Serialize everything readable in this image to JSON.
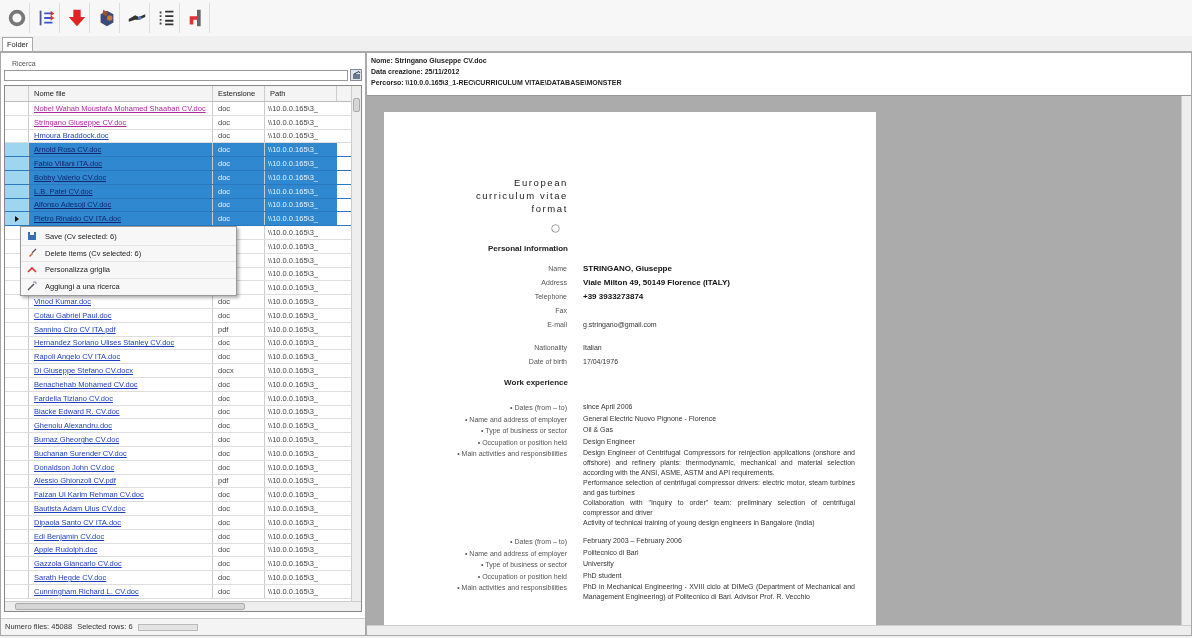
{
  "toolbar": {
    "buttons": [
      {
        "kind": "refresh"
      },
      {
        "kind": "move"
      },
      {
        "kind": "download"
      },
      {
        "kind": "package"
      },
      {
        "kind": "tool"
      },
      {
        "kind": "list"
      },
      {
        "kind": "pipe"
      }
    ]
  },
  "tabs": [
    {
      "label": "Folder",
      "selected": true
    }
  ],
  "search": {
    "label": "Ricerca"
  },
  "file_table": {
    "columns": [
      "Nome file",
      "Estensione",
      "Path"
    ],
    "rows": [
      {
        "name": "Nobel Wahab Moustafa Mohamed Shaaban CV.doc",
        "extension": "doc",
        "path": "\\\\10.0.0.165\\3_",
        "selected": false,
        "visited": true,
        "current": false
      },
      {
        "name": "Stringano Giuseppe CV.doc",
        "extension": "doc",
        "path": "\\\\10.0.0.165\\3_",
        "selected": false,
        "visited": true,
        "current": false
      },
      {
        "name": "Hmoura Braddock.doc",
        "extension": "doc",
        "path": "\\\\10.0.0.165\\3_",
        "selected": false,
        "visited": false,
        "current": false
      },
      {
        "name": "Arnold Rosa CV.doc",
        "extension": "doc",
        "path": "\\\\10.0.0.165\\3_",
        "selected": true,
        "current": false
      },
      {
        "name": "Fabio Villani ITA.doc",
        "extension": "doc",
        "path": "\\\\10.0.0.165\\3_",
        "selected": true,
        "current": false
      },
      {
        "name": "Bobby Valerio CV.doc",
        "extension": "doc",
        "path": "\\\\10.0.0.165\\3_",
        "selected": true,
        "current": false
      },
      {
        "name": "L.B. Patel CV.doc",
        "extension": "doc",
        "path": "\\\\10.0.0.165\\3_",
        "selected": true,
        "current": false
      },
      {
        "name": "Alfonso Adesoji CV.doc",
        "extension": "doc",
        "path": "\\\\10.0.0.165\\3_",
        "selected": true,
        "current": false
      },
      {
        "name": "Pietro Rinaldo CV ITA.doc",
        "extension": "doc",
        "path": "\\\\10.0.0.165\\3_",
        "selected": true,
        "current": true
      },
      {
        "path": "\\\\10.0.0.165\\3_",
        "selected": false,
        "current": false
      },
      {
        "path": "\\\\10.0.0.165\\3_",
        "selected": false,
        "current": false
      },
      {
        "path": "\\\\10.0.0.165\\3_",
        "selected": false,
        "current": false
      },
      {
        "path": "\\\\10.0.0.165\\3_",
        "selected": false,
        "current": false
      },
      {
        "path": "\\\\10.0.0.165\\3_",
        "selected": false,
        "current": false
      },
      {
        "name": "Vinod Kumar.doc",
        "extension": "doc",
        "path": "\\\\10.0.0.165\\3_",
        "selected": false,
        "visited": false,
        "current": false
      },
      {
        "name": "Cotau Gabriel Paul.doc",
        "extension": "doc",
        "path": "\\\\10.0.0.165\\3_",
        "selected": false,
        "visited": false,
        "current": false
      },
      {
        "name": "Sannino Ciro CV ITA.pdf",
        "extension": "pdf",
        "path": "\\\\10.0.0.165\\3_",
        "selected": false,
        "visited": false,
        "current": false
      },
      {
        "name": "Hernandez Soriano Ulises Stanley CV.doc",
        "extension": "doc",
        "path": "\\\\10.0.0.165\\3_",
        "selected": false,
        "visited": false,
        "current": false
      },
      {
        "name": "Rapoli Angelo CV ITA.doc",
        "extension": "doc",
        "path": "\\\\10.0.0.165\\3_",
        "selected": false,
        "visited": false,
        "current": false
      },
      {
        "name": "Di Giuseppe Stefano CV.docx",
        "extension": "docx",
        "path": "\\\\10.0.0.165\\3_",
        "selected": false,
        "visited": false,
        "current": false
      },
      {
        "name": "Benachehab Mohamed CV.doc",
        "extension": "doc",
        "path": "\\\\10.0.0.165\\3_",
        "selected": false,
        "visited": false,
        "current": false
      },
      {
        "name": "Fardella Tiziano CV.doc",
        "extension": "doc",
        "path": "\\\\10.0.0.165\\3_",
        "selected": false,
        "visited": false,
        "current": false
      },
      {
        "name": "Blacke Edward R. CV.doc",
        "extension": "doc",
        "path": "\\\\10.0.0.165\\3_",
        "selected": false,
        "visited": false,
        "current": false
      },
      {
        "name": "Ghenoiu Alexandru.doc",
        "extension": "doc",
        "path": "\\\\10.0.0.165\\3_",
        "selected": false,
        "visited": false,
        "current": false
      },
      {
        "name": "Burnaz Gheorghe CV.doc",
        "extension": "doc",
        "path": "\\\\10.0.0.165\\3_",
        "selected": false,
        "visited": false,
        "current": false
      },
      {
        "name": "Buchanan Surender CV.doc",
        "extension": "doc",
        "path": "\\\\10.0.0.165\\3_",
        "selected": false,
        "visited": false,
        "current": false
      },
      {
        "name": "Donaldson John CV.doc",
        "extension": "doc",
        "path": "\\\\10.0.0.165\\3_",
        "selected": false,
        "visited": false,
        "current": false
      },
      {
        "name": "Alessio Ghionzoli CV.pdf",
        "extension": "pdf",
        "path": "\\\\10.0.0.165\\3_",
        "selected": false,
        "visited": false,
        "current": false
      },
      {
        "name": "Faizan Ul Karim Rehman CV.doc",
        "extension": "doc",
        "path": "\\\\10.0.0.165\\3_",
        "selected": false,
        "visited": false,
        "current": false
      },
      {
        "name": "Bautista Adam Ulus CV.doc",
        "extension": "doc",
        "path": "\\\\10.0.0.165\\3_",
        "selected": false,
        "visited": false,
        "current": false
      },
      {
        "name": "Dipaola Santo CV ITA.doc",
        "extension": "doc",
        "path": "\\\\10.0.0.165\\3_",
        "selected": false,
        "visited": false,
        "current": false
      },
      {
        "name": "Edi Benjamin CV.doc",
        "extension": "doc",
        "path": "\\\\10.0.0.165\\3_",
        "selected": false,
        "visited": false,
        "current": false
      },
      {
        "name": "Apple Rudolph.doc",
        "extension": "doc",
        "path": "\\\\10.0.0.165\\3_",
        "selected": false,
        "visited": false,
        "current": false
      },
      {
        "name": "Gazzola Giancarlo CV.doc",
        "extension": "doc",
        "path": "\\\\10.0.0.165\\3_",
        "selected": false,
        "visited": false,
        "current": false
      },
      {
        "name": "Sarath Hegde CV.doc",
        "extension": "doc",
        "path": "\\\\10.0.0.165\\3_",
        "selected": false,
        "visited": false,
        "current": false
      },
      {
        "name": "Cunningham Richard L. CV.doc",
        "extension": "doc",
        "path": "\\\\10.0.0.165\\3_",
        "selected": false,
        "visited": false,
        "current": false
      }
    ]
  },
  "context_menu": {
    "items": [
      {
        "label": "Save (Cv selected: 6)",
        "kind": "save"
      },
      {
        "label": "Delete items (Cv selected: 6)",
        "kind": "delete"
      },
      {
        "label": "Personalizza griglia",
        "kind": "grid"
      },
      {
        "label": "Aggiungi a una ricerca",
        "kind": "add"
      }
    ]
  },
  "status_bar": {
    "file_count": "Numero files: 45088",
    "selected_rows": "Selected rows: 6",
    "progress": {
      "level": 0
    }
  },
  "file_info": {
    "name": "Nome: Stringano Giuseppe CV.doc",
    "created": "Data creazione: 25/11/2012",
    "path": "Percorso: \\\\10.0.0.165\\3_1-REC\\CURRICULUM VITAE\\DATABASE\\MONSTER"
  },
  "document": {
    "title_lines": [
      "European",
      "curriculum vitae",
      "format"
    ],
    "personal": {
      "heading": "Personal information",
      "groups": [
        [
          {
            "label": "Name",
            "value": "STRINGANO, Giuseppe"
          },
          {
            "label": "Address",
            "value": "Viale Milton 49, 50149 Florence (ITALY)"
          },
          {
            "label": "Telephone",
            "value": "+39 3933273874"
          },
          {
            "label": "Fax"
          },
          {
            "label": "E-mail",
            "value": "g.stringano@gmail.com"
          }
        ],
        [
          {
            "label": "Nationality",
            "value": "Italian"
          },
          {
            "label": "Date of birth",
            "value": "17/04/1976"
          }
        ]
      ]
    },
    "work": {
      "heading": "Work experience",
      "entries": [
        [
          {
            "label": "• Dates (from – to)",
            "paragraphs": [
              "since April 2006"
            ]
          },
          {
            "label": "• Name and address of employer",
            "paragraphs": [
              "General Electric Nuovo Pignone - Florence"
            ]
          },
          {
            "label": "• Type of business or sector",
            "paragraphs": [
              "Oil & Gas"
            ]
          },
          {
            "label": "• Occupation or position held",
            "paragraphs": [
              "Design Engineer"
            ]
          },
          {
            "label": "• Main activities and responsibilities",
            "paragraphs": [
              "Design Engineer of Centrifugal Compressors for reinjection applications (onshore and offshore) and refinery plants: thermodynamic, mechanical and material selection according with the ANSI, ASME, ASTM and API requirements.",
              "Performance selection of centrifugal compressor drivers: electric motor, steam turbines and gas turbines",
              "Collaboration with \"Inquiry to order\" team: preliminary selection of centrifugal compressor and driver",
              "Activity of technical training of young design engineers in Bangalore (India)"
            ]
          }
        ],
        [
          {
            "label": "• Dates (from – to)",
            "paragraphs": [
              "February 2003 – February 2006"
            ]
          },
          {
            "label": "• Name and address of employer",
            "paragraphs": [
              "Politecnico di Bari"
            ]
          },
          {
            "label": "• Type of business or sector",
            "paragraphs": [
              "University"
            ]
          },
          {
            "label": "• Occupation or position held",
            "paragraphs": [
              "PhD student"
            ]
          },
          {
            "label": "• Main activities and responsibilities",
            "paragraphs": [
              "PhD in Mechanical Engineering - XVIII ciclo at DIMeG (Department of Mechanical and Management Engineering) of Politecnico di Bari. Advisor Prof. R. Vecchio"
            ]
          }
        ]
      ]
    }
  }
}
